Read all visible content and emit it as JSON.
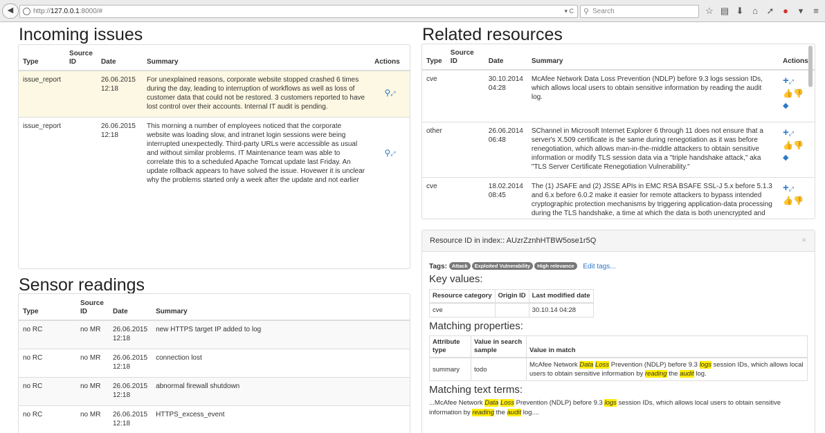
{
  "browser": {
    "url_dim": "http://",
    "url_host": "127.0.0.1",
    "url_rest": ":8000/#",
    "search_placeholder": "Search",
    "back_glyph": "◀",
    "url_ctl": "▾ C"
  },
  "incoming": {
    "title": "Incoming issues",
    "headers": [
      "Type",
      "Source ID",
      "Date",
      "Summary",
      "Actions"
    ],
    "rows": [
      {
        "type": "issue_report",
        "source": "",
        "date": "26.06.2015 12:18",
        "summary": "For unexplained reasons, corporate website stopped crashed 6 times during the day, leading to interruption of workflows as well as loss of customer data that could not be restored. 3 customers reported to have lost control over their accounts. Internal IT audit is pending."
      },
      {
        "type": "issue_report",
        "source": "",
        "date": "26.06.2015 12:18",
        "summary": "This morning a number of employees noticed that the corporate website was loading slow, and intranet login sessions were being interrupted unexpectedly. Third-party URLs were accessible as usual and without similar problems. IT Maintenance team was able to correlate this to a scheduled Apache Tomcat update last Friday. An update rollback appears to have solved the issue. Hovewer it is unclear why the problems started only a week after the update and not earlier"
      }
    ]
  },
  "sensor": {
    "title": "Sensor readings",
    "headers": [
      "Type",
      "Source ID",
      "Date",
      "Summary"
    ],
    "rows": [
      {
        "type": "no RC",
        "source": "no MR",
        "date": "26.06.2015 12:18",
        "summary": "new HTTPS target IP added to log"
      },
      {
        "type": "no RC",
        "source": "no MR",
        "date": "26.06.2015 12:18",
        "summary": "connection lost"
      },
      {
        "type": "no RC",
        "source": "no MR",
        "date": "26.06.2015 12:18",
        "summary": "abnormal firewall shutdown"
      },
      {
        "type": "no RC",
        "source": "no MR",
        "date": "26.06.2015 12:18",
        "summary": "HTTPS_excess_event"
      }
    ]
  },
  "related": {
    "title": "Related resources",
    "headers": [
      "Type",
      "Source ID",
      "Date",
      "Summary",
      "Actions"
    ],
    "rows": [
      {
        "type": "cve",
        "source": "",
        "date": "30.10.2014 04:28",
        "summary": "McAfee Network Data Loss Prevention (NDLP) before 9.3 logs session IDs, which allows local users to obtain sensitive information by reading the audit log."
      },
      {
        "type": "other",
        "source": "",
        "date": "26.06.2014 06:48",
        "summary": "SChannel in Microsoft Internet Explorer 6 through 11 does not ensure that a server's X.509 certificate is the same during renegotiation as it was before renegotiation, which allows man-in-the-middle attackers to obtain sensitive information or modify TLS session data via a \"triple handshake attack,\" aka \"TLS Server Certificate Renegotiation Vulnerability.\""
      },
      {
        "type": "cve",
        "source": "",
        "date": "18.02.2014 08:45",
        "summary": "The (1) JSAFE and (2) JSSE APIs in EMC RSA BSAFE SSL-J 5.x before 5.1.3 and 6.x before 6.0.2 make it easier for remote attackers to bypass intended cryptographic protection mechanisms by triggering application-data processing during the TLS handshake, a time at which the data is both unencrypted and"
      }
    ]
  },
  "detail": {
    "header": "Resource ID in index:: AUzrZznhHTBW5ose1r5Q",
    "close": "×",
    "tags_label": "Tags:",
    "tags": [
      "Attack",
      "Exploited Vulnerability",
      "High relevance"
    ],
    "edit_tags": "Edit tags...",
    "key_values_title": "Key values:",
    "kv_headers": [
      "Resource category",
      "Origin ID",
      "Last modified date"
    ],
    "kv_row": [
      "cve",
      "",
      "30.10.14 04:28"
    ],
    "matching_props_title": "Matching properties:",
    "mp_headers": [
      "Attribute type",
      "Value in search sample",
      "Value in match"
    ],
    "mp_row": {
      "attr": "summary",
      "sample": "todo"
    },
    "matching_terms_title": "Matching text terms:",
    "match_text": {
      "p1": "McAfee Network ",
      "h1": "Data",
      "s1": " ",
      "h2": "Loss",
      "p2": " Prevention (NDLP) before 9.3 ",
      "h3": "logs",
      "p3": " session IDs, which allows local users to obtain sensitive information by ",
      "h4": "reading",
      "p4": " the ",
      "h5": "audit",
      "p5": " log."
    },
    "terms_text": {
      "p0": "...McAfee Network ",
      "h1": "Data",
      "s1": " ",
      "h2": "Loss",
      "p2": " Prevention (NDLP) before 9.3 ",
      "h3": "logs",
      "p3": " session IDs, which allows local users to obtain sensitive information by ",
      "h4": "reading",
      "p4": " the ",
      "h5": "audit",
      "p5": " log...."
    }
  }
}
